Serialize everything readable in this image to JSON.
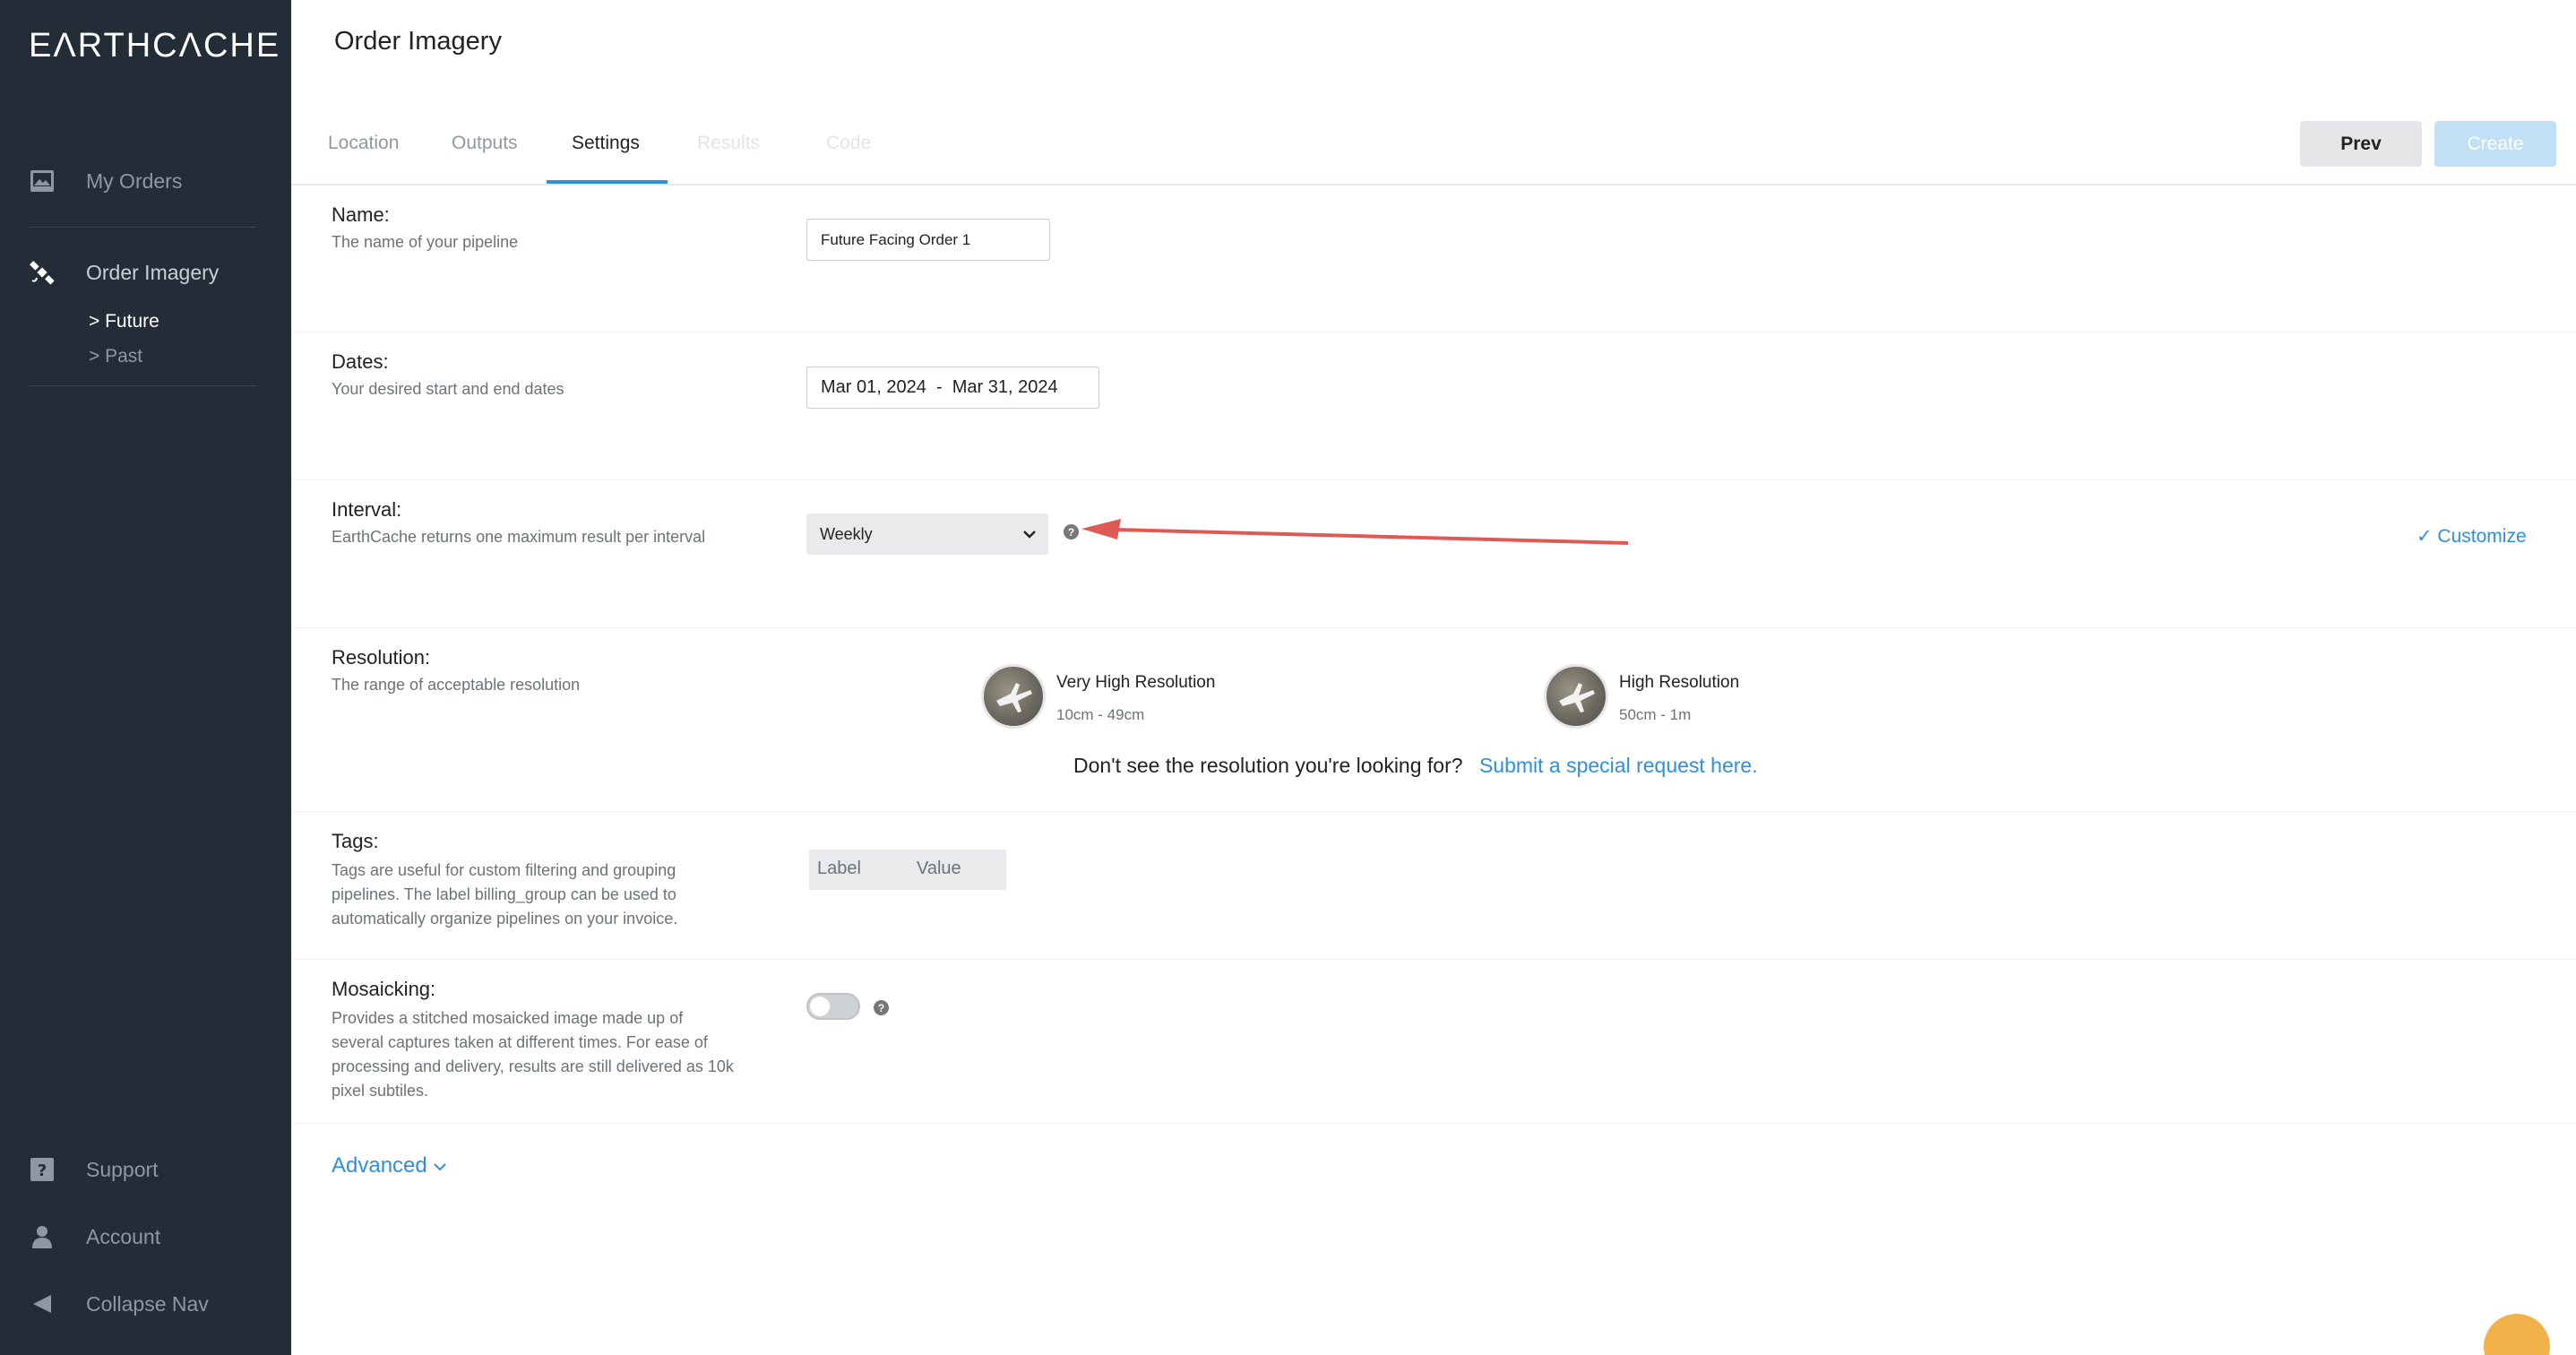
{
  "sidebar": {
    "logo": "EΛRTHCΛCHE",
    "my_orders": "My Orders",
    "order_imagery": "Order Imagery",
    "future": "> Future",
    "past": "> Past",
    "support": "Support",
    "account": "Account",
    "collapse": "Collapse Nav"
  },
  "header": {
    "title": "Order Imagery"
  },
  "tabs": {
    "location": "Location",
    "outputs": "Outputs",
    "settings": "Settings",
    "results": "Results",
    "code": "Code"
  },
  "buttons": {
    "prev": "Prev",
    "create": "Create"
  },
  "name": {
    "label": "Name:",
    "desc": "The name of your pipeline",
    "value": "Future Facing Order 1"
  },
  "dates": {
    "label": "Dates:",
    "desc": "Your desired start and end dates",
    "value": "Mar 01, 2024  -  Mar 31, 2024"
  },
  "interval": {
    "label": "Interval:",
    "desc": "EarthCache returns one maximum result per interval",
    "selected": "Weekly",
    "customize": "✓ Customize"
  },
  "resolution": {
    "label": "Resolution:",
    "desc": "The range of acceptable resolution",
    "options": [
      {
        "title": "Very High Resolution",
        "range": "10cm - 49cm"
      },
      {
        "title": "High Resolution",
        "range": "50cm - 1m"
      }
    ],
    "note": "Don't see the resolution you're looking for?",
    "note_link": "Submit a special request here."
  },
  "tags": {
    "label": "Tags:",
    "desc_lines": [
      "Tags are useful for custom filtering and grouping",
      "pipelines. The label billing_group can be used to",
      "automatically organize pipelines on your invoice."
    ],
    "col_label": "Label",
    "col_value": "Value"
  },
  "mosaicking": {
    "label": "Mosaicking:",
    "desc_lines": [
      "Provides a stitched mosaicked image made up of",
      "several captures taken at different times. For ease of",
      "processing and delivery, results are still delivered as 10k",
      "pixel subtiles."
    ],
    "enabled": false
  },
  "advanced": "Advanced",
  "colors": {
    "sidebar_bg": "#232d37",
    "accent": "#2f8fd8",
    "arrow": "#e05a55",
    "chat": "#f2b24a"
  }
}
